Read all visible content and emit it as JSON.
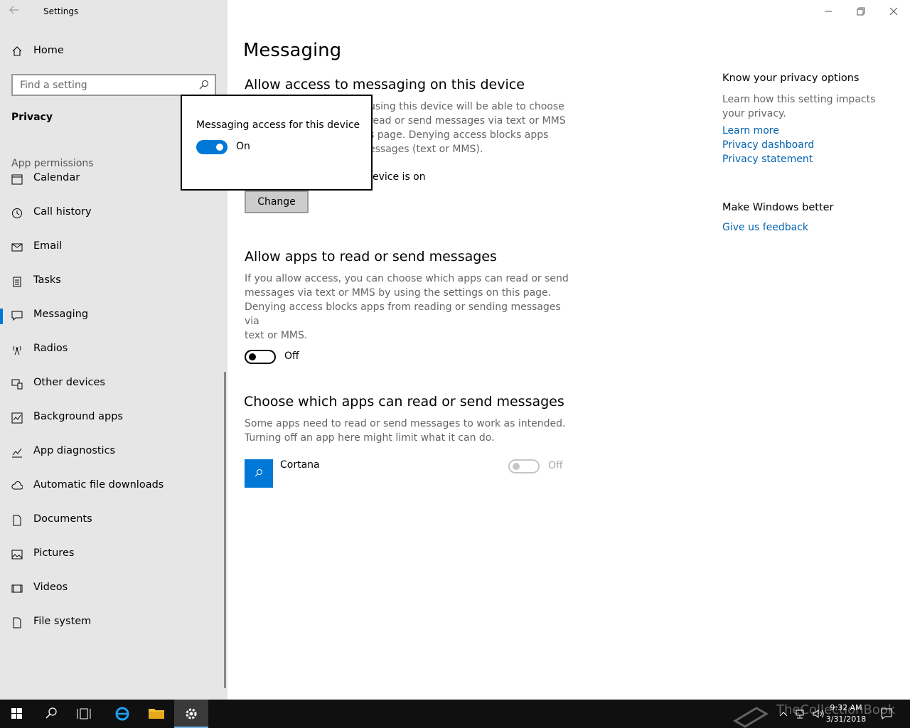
{
  "window": {
    "title": "Settings"
  },
  "sidebar": {
    "home_label": "Home",
    "search_placeholder": "Find a setting",
    "section": "Privacy",
    "group": "App permissions",
    "items": [
      {
        "label": "Calendar",
        "icon": "calendar-icon"
      },
      {
        "label": "Call history",
        "icon": "history-icon"
      },
      {
        "label": "Email",
        "icon": "mail-icon"
      },
      {
        "label": "Tasks",
        "icon": "tasks-icon"
      },
      {
        "label": "Messaging",
        "icon": "message-icon",
        "active": true
      },
      {
        "label": "Radios",
        "icon": "radio-antenna-icon"
      },
      {
        "label": "Other devices",
        "icon": "devices-icon"
      },
      {
        "label": "Background apps",
        "icon": "background-apps-icon"
      },
      {
        "label": "App diagnostics",
        "icon": "diagnostics-icon"
      },
      {
        "label": "Automatic file downloads",
        "icon": "cloud-icon"
      },
      {
        "label": "Documents",
        "icon": "document-icon"
      },
      {
        "label": "Pictures",
        "icon": "picture-icon"
      },
      {
        "label": "Videos",
        "icon": "video-icon"
      },
      {
        "label": "File system",
        "icon": "file-icon"
      }
    ]
  },
  "main": {
    "title": "Messaging",
    "section1": {
      "heading": "Allow access to messaging on this device",
      "desc_lines": [
        "using this device will be able to choose",
        "read or send messages via text or MMS",
        "s page. Denying access blocks apps",
        "essages (text or MMS)."
      ],
      "status": "evice is on",
      "change_label": "Change"
    },
    "section2": {
      "heading": "Allow apps to read or send messages",
      "desc_lines": [
        "If you allow access, you can choose which apps can read or send",
        "messages via text or MMS by using the settings on this page.",
        "Denying access blocks apps from reading or sending messages via",
        "text or MMS."
      ],
      "toggle_state": "Off"
    },
    "section3": {
      "heading": "Choose which apps can read or send messages",
      "desc_lines": [
        "Some apps need to read or send messages to work as intended.",
        "Turning off an app here might limit what it can do."
      ],
      "apps": [
        {
          "name": "Cortana",
          "state": "Off",
          "icon": "cortana-icon"
        }
      ]
    },
    "right": {
      "privacy_heading": "Know your privacy options",
      "privacy_desc": "Learn how this setting impacts your privacy.",
      "links": [
        "Learn more",
        "Privacy dashboard",
        "Privacy statement"
      ],
      "better_heading": "Make Windows better",
      "feedback_link": "Give us feedback"
    }
  },
  "popup": {
    "label": "Messaging access for this device",
    "state": "On"
  },
  "taskbar": {
    "time": "9:32 AM",
    "date": "3/31/2018",
    "watermark": "TheCollectionBook"
  },
  "colors": {
    "accent": "#0078d7",
    "link": "#0063b1"
  }
}
